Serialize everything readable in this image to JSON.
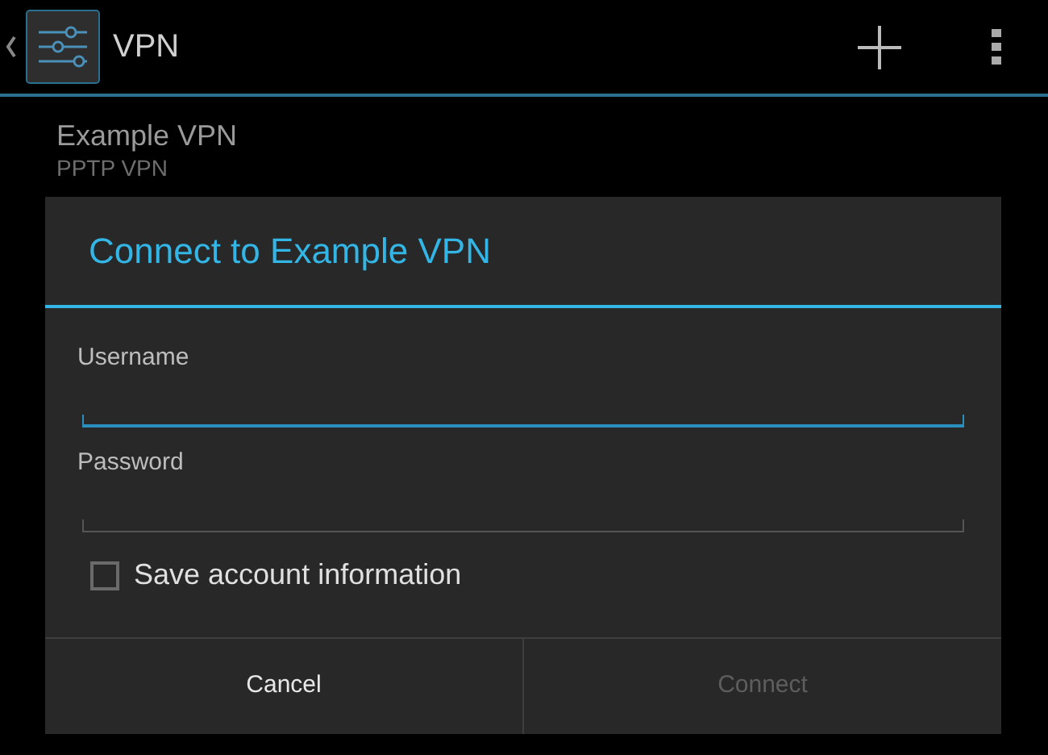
{
  "action_bar": {
    "title": "VPN"
  },
  "vpn_list": [
    {
      "name": "Example VPN",
      "type": "PPTP VPN"
    }
  ],
  "dialog": {
    "title": "Connect to Example VPN",
    "fields": [
      {
        "label": "Username",
        "focused": true
      },
      {
        "label": "Password",
        "focused": false
      }
    ],
    "checkbox": {
      "label": "Save account information",
      "checked": false
    },
    "buttons": [
      {
        "label": "Cancel",
        "disabled": false
      },
      {
        "label": "Connect",
        "disabled": true
      }
    ]
  }
}
